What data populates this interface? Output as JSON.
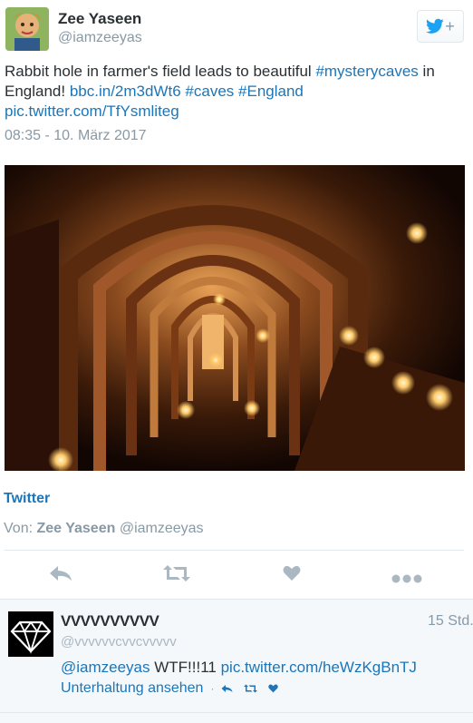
{
  "tweet": {
    "author_name": "Zee Yaseen",
    "author_handle": "@iamzeeyas",
    "text_plain_1": "Rabbit hole in farmer's field leads to beautiful ",
    "hashtag_1": "#mysterycaves",
    "text_plain_2": " in England! ",
    "link_1": "bbc.in/2m3dWt6",
    "text_plain_3": " ",
    "hashtag_2": "#caves",
    "text_plain_4": " ",
    "hashtag_3": "#England",
    "pic_link": "pic.twitter.com/TfYsmliteg",
    "timestamp": "08:35 - 10. März 2017",
    "source": "Twitter",
    "byline_prefix": "Von:",
    "byline_name": "Zee Yaseen",
    "byline_handle": "@iamzeeyas"
  },
  "follow_button": {
    "icon": "twitter-bird-icon",
    "plus": "+"
  },
  "actions": [
    "reply-icon",
    "retweet-icon",
    "like-icon",
    "more-icon"
  ],
  "reply": {
    "name": "VVVVVVVVVV",
    "time": "15 Std.",
    "handle": "@vvvvvvcvvcvvvvv",
    "mention": "@iamzeeyas",
    "text": " WTF!!!11 ",
    "pic_link": "pic.twitter.com/heWzKgBnTJ",
    "conversation_link": "Unterhaltung ansehen",
    "separator": "·"
  },
  "colors": {
    "link": "#1b76b9",
    "muted": "#8899a6",
    "text": "#292f33",
    "twitter_blue": "#1da1f2"
  }
}
